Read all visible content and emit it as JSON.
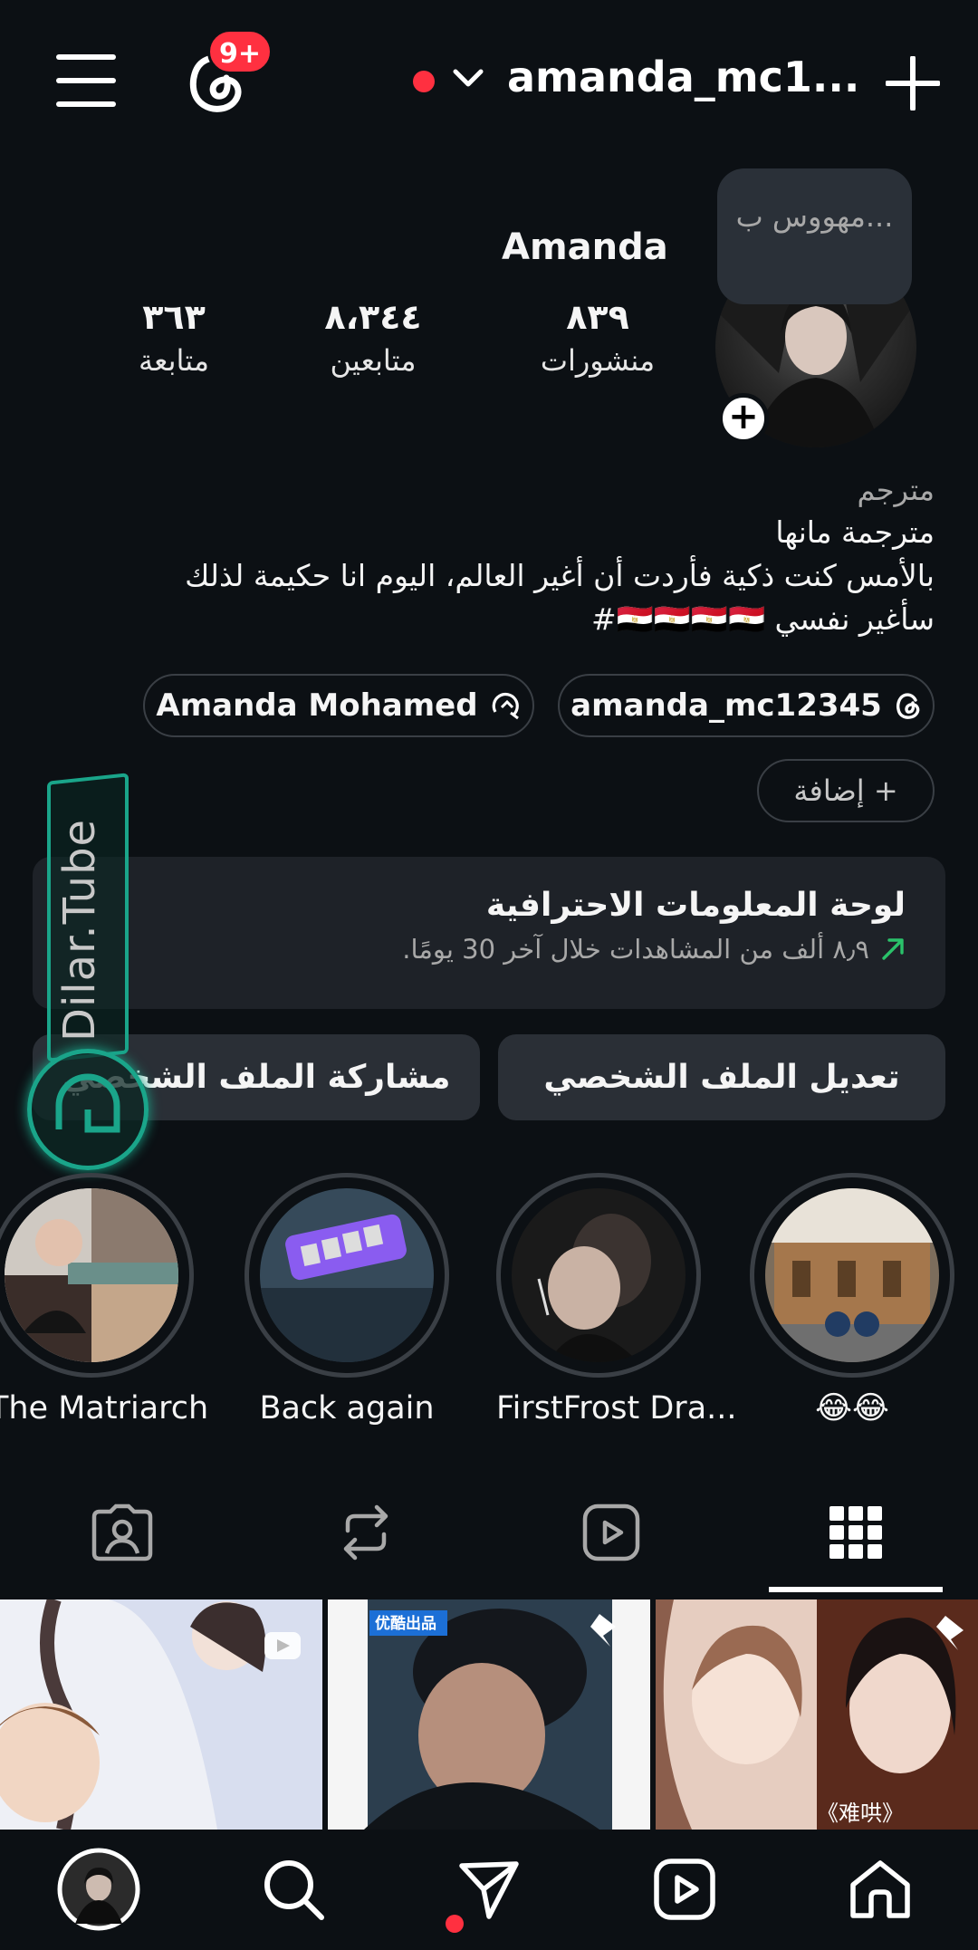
{
  "header": {
    "username": "amanda_mc1...",
    "threads_badge": "9+",
    "colors": {
      "background": "#0c1014",
      "badge": "#ff3040",
      "accent": "#1aa58a"
    }
  },
  "profile": {
    "display_name": "Amanda",
    "note": "مهووس ب...",
    "stats": [
      {
        "value": "٨٣٩",
        "label": "منشورات"
      },
      {
        "value": "٨،٣٤٤",
        "label": "متابعين"
      },
      {
        "value": "٣٦٣",
        "label": "متابعة"
      }
    ]
  },
  "bio": {
    "category": "مترجم",
    "lines": [
      "مترجمة مانها",
      "بالأمس كنت ذكية فأردت أن أغير العالم، اليوم انا حكيمة لذلك",
      "سأغير نفسي 🇪🇬🇪🇬🇪🇬🇪🇬#"
    ]
  },
  "links": {
    "threads": "amanda_mc12345",
    "facebook": "Amanda Mohamed",
    "add": "+ إضافة"
  },
  "dashboard": {
    "title": "لوحة المعلومات الاحترافية",
    "subtitle": "٨٫٩ ألف من المشاهدات خلال آخر 30 يومًا."
  },
  "buttons": {
    "edit": "تعديل الملف الشخصي",
    "share": "مشاركة الملف الشخصي"
  },
  "watermark": {
    "text": "Dilar.Tube"
  },
  "highlights": [
    {
      "label": "The Matriarch"
    },
    {
      "label": "Back again"
    },
    {
      "label": "FirstFrost Dra..."
    },
    {
      "label": "😂😂"
    }
  ],
  "tabs": [
    "tagged-icon",
    "reposts-icon",
    "reels-icon",
    "grid-icon"
  ],
  "grid_thumb_text": {
    "badge": "优酷出品",
    "caption": "《难哄》"
  },
  "bottom_nav": [
    "profile-avatar",
    "search-icon",
    "send-icon",
    "reels-icon",
    "home-icon"
  ]
}
